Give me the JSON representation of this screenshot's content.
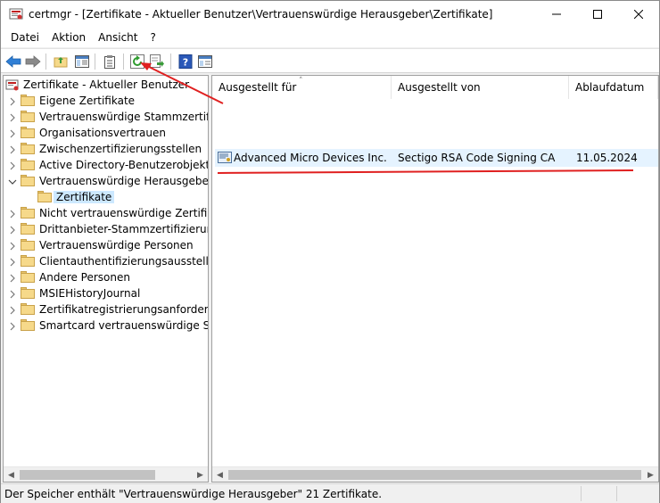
{
  "window": {
    "title": "certmgr - [Zertifikate - Aktueller Benutzer\\Vertrauenswürdige Herausgeber\\Zertifikate]",
    "app_icon": "certificate-manager-icon"
  },
  "menu": {
    "items": [
      {
        "label": "Datei"
      },
      {
        "label": "Aktion"
      },
      {
        "label": "Ansicht"
      },
      {
        "label": "?"
      }
    ]
  },
  "toolbar": {
    "buttons": [
      {
        "icon": "back-arrow-icon"
      },
      {
        "icon": "forward-arrow-icon"
      },
      {
        "icon": "up-folder-icon"
      },
      {
        "icon": "show-hide-tree-icon"
      },
      {
        "icon": "clipboard-icon"
      },
      {
        "icon": "refresh-icon"
      },
      {
        "icon": "export-list-icon"
      },
      {
        "icon": "help-icon"
      },
      {
        "icon": "properties-icon"
      }
    ]
  },
  "tree": {
    "root": "Zertifikate - Aktueller Benutzer",
    "items": [
      {
        "label": "Eigene Zertifikate",
        "expanded": false
      },
      {
        "label": "Vertrauenswürdige Stammzertifizier",
        "expanded": false
      },
      {
        "label": "Organisationsvertrauen",
        "expanded": false
      },
      {
        "label": "Zwischenzertifizierungsstellen",
        "expanded": false
      },
      {
        "label": "Active Directory-Benutzerobjekt",
        "expanded": false
      },
      {
        "label": "Vertrauenswürdige Herausgeber",
        "expanded": true
      },
      {
        "label": "Zertifikate",
        "child": true,
        "selected": true
      },
      {
        "label": "Nicht vertrauenswürdige Zertifikate",
        "expanded": false
      },
      {
        "label": "Drittanbieter-Stammzertifizierungss",
        "expanded": false
      },
      {
        "label": "Vertrauenswürdige Personen",
        "expanded": false
      },
      {
        "label": "Clientauthentifizierungsaussteller",
        "expanded": false
      },
      {
        "label": "Andere Personen",
        "expanded": false
      },
      {
        "label": "MSIEHistoryJournal",
        "expanded": false
      },
      {
        "label": "Zertifikatregistrierungsanforderung",
        "expanded": false
      },
      {
        "label": "Smartcard vertrauenswürdige Stäm",
        "expanded": false
      }
    ]
  },
  "list": {
    "columns": [
      "Ausgestellt für",
      "Ausgestellt von",
      "Ablaufdatum"
    ],
    "rows": [
      {
        "issued_to": "Advanced Micro Devices Inc.",
        "issued_by": "Sectigo RSA Code Signing CA",
        "expires": "11.05.2024"
      }
    ]
  },
  "status": {
    "text": "Der Speicher enthält \"Vertrauenswürdige Herausgeber\" 21 Zertifikate."
  },
  "colors": {
    "annotation": "#e02020",
    "selection": "#cce8ff",
    "row_highlight": "#e5f3ff"
  }
}
